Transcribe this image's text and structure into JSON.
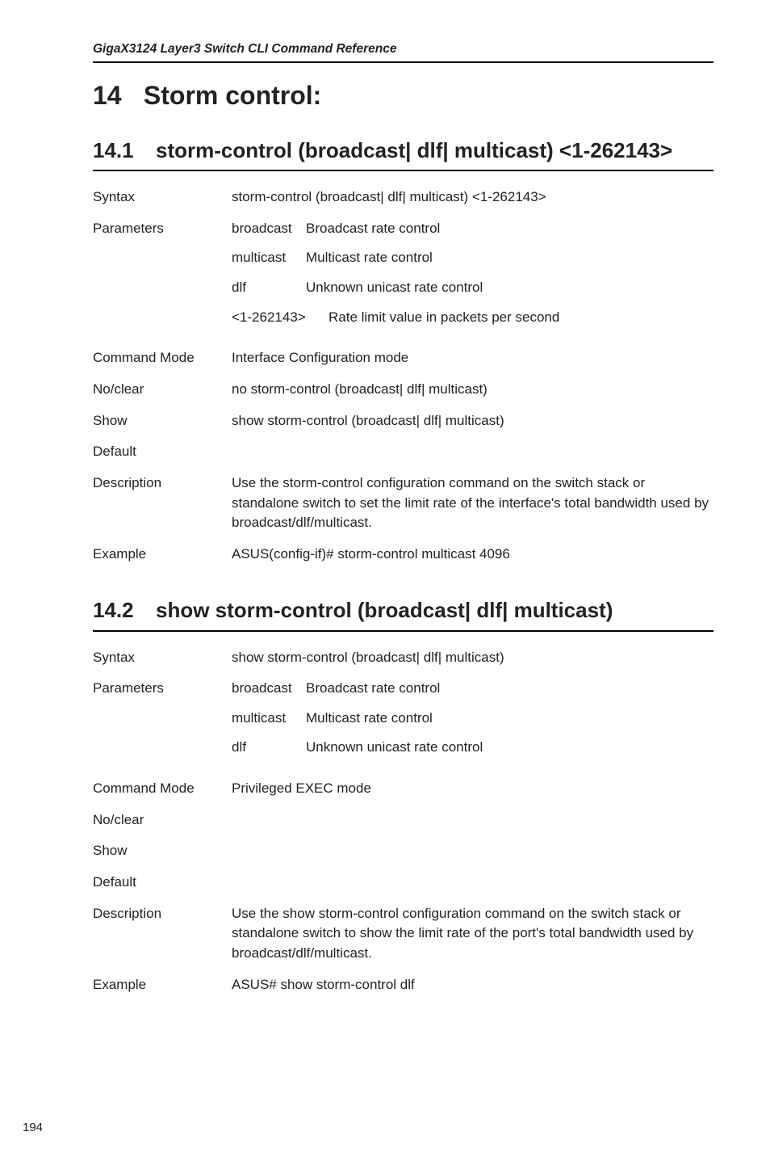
{
  "header": "GigaX3124 Layer3 Switch CLI Command Reference",
  "chapter": {
    "num": "14",
    "title": "Storm control:"
  },
  "section1": {
    "num": "14.1",
    "title": "storm-control (broadcast| dlf| multicast) <1-262143>",
    "rows": {
      "syntax_label": "Syntax",
      "syntax_value": "storm-control (broadcast| dlf| multicast) <1-262143>",
      "params_label": "Parameters",
      "param_broadcast_key": "broadcast",
      "param_broadcast_val": "Broadcast rate control",
      "param_multicast_key": "multicast",
      "param_multicast_val": "Multicast rate control",
      "param_dlf_key": "dlf",
      "param_dlf_val": "Unknown unicast rate control",
      "param_range_key": "<1-262143>",
      "param_range_val": "Rate limit value in packets per second",
      "cmdmode_label": "Command Mode",
      "cmdmode_value": "Interface Configuration mode",
      "noclear_label": "No/clear",
      "noclear_value": "no storm-control (broadcast| dlf| multicast)",
      "show_label": "Show",
      "show_value": "show storm-control (broadcast| dlf| multicast)",
      "default_label": "Default",
      "default_value": "",
      "desc_label": "Description",
      "desc_value": "Use the storm-control configuration command on the switch stack or standalone switch to set the limit rate of the interface's total bandwidth used by broadcast/dlf/multicast.",
      "example_label": "Example",
      "example_value": "ASUS(config-if)# storm-control multicast 4096"
    }
  },
  "section2": {
    "num": "14.2",
    "title": "show storm-control (broadcast| dlf| multicast)",
    "rows": {
      "syntax_label": "Syntax",
      "syntax_value": "show storm-control (broadcast| dlf| multicast)",
      "params_label": "Parameters",
      "param_broadcast_key": "broadcast",
      "param_broadcast_val": "Broadcast rate control",
      "param_multicast_key": "multicast",
      "param_multicast_val": "Multicast rate control",
      "param_dlf_key": "dlf",
      "param_dlf_val": "Unknown unicast rate control",
      "cmdmode_label": "Command Mode",
      "cmdmode_value": "Privileged EXEC mode",
      "noclear_label": "No/clear",
      "noclear_value": "",
      "show_label": "Show",
      "show_value": "",
      "default_label": "Default",
      "default_value": "",
      "desc_label": "Description",
      "desc_value": "Use the show storm-control configuration command on the switch stack or standalone switch to show the limit rate of the port's total bandwidth used by broadcast/dlf/multicast.",
      "example_label": "Example",
      "example_value": "ASUS# show storm-control dlf"
    }
  },
  "page_number": "194"
}
